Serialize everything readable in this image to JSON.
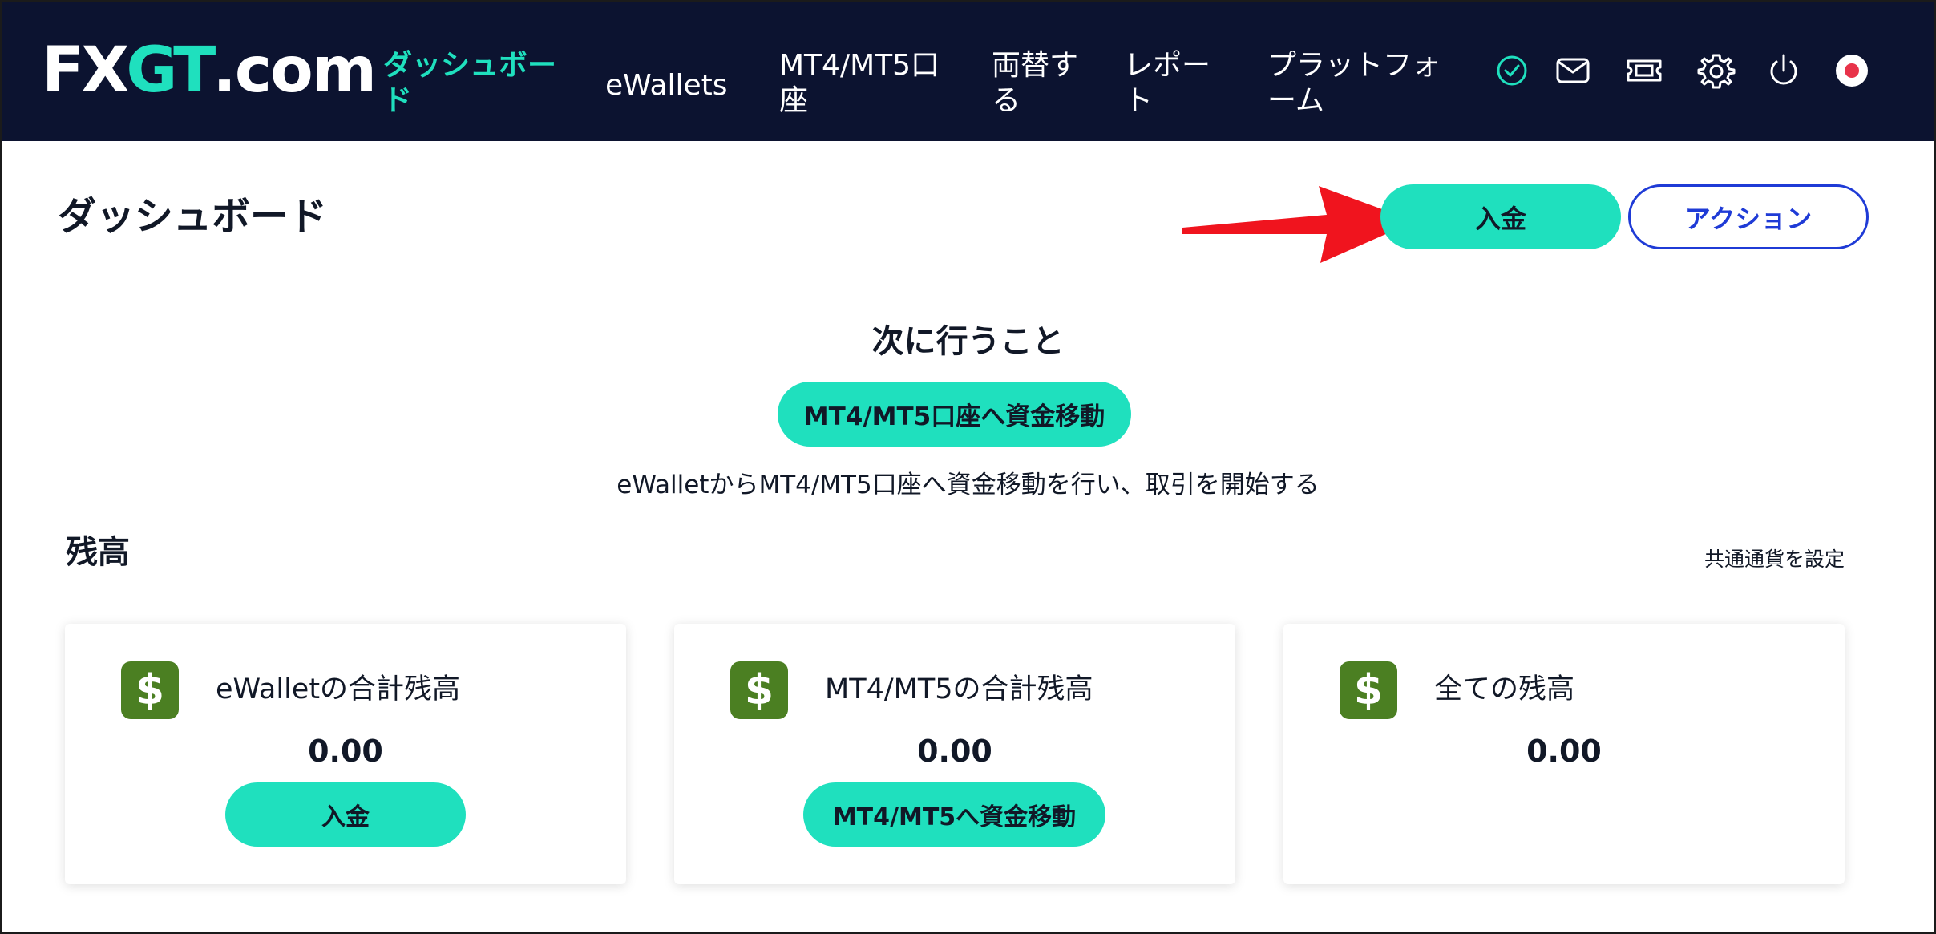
{
  "header": {
    "logo": {
      "part1": "FX",
      "part2": "GT",
      "part3": ".com"
    },
    "nav": [
      {
        "line1": "ダッシュボー",
        "line2": "ド",
        "active": true
      },
      {
        "line1": "eWallets",
        "line2": "",
        "active": false
      },
      {
        "line1": "MT4/MT5口",
        "line2": "座",
        "active": false
      },
      {
        "line1": "両替す",
        "line2": "る",
        "active": false
      },
      {
        "line1": "レポー",
        "line2": "ト",
        "active": false
      },
      {
        "line1": "プラットフォ",
        "line2": "ーム",
        "active": false
      }
    ],
    "icons": [
      "verified-check-icon",
      "mail-icon",
      "ticket-icon",
      "gear-icon",
      "power-icon",
      "japan-flag-icon"
    ],
    "colors": {
      "background": "#0c1330",
      "accent": "#1fe0be"
    }
  },
  "page": {
    "title": "ダッシュボード",
    "deposit_button": "入金",
    "action_button": "アクション"
  },
  "next_steps": {
    "title": "次に行うこと",
    "button": "MT4/MT5口座へ資金移動",
    "description": "eWalletからMT4/MT5口座へ資金移動を行い、取引を開始する"
  },
  "balance": {
    "title": "残高",
    "currency_link": "共通通貨を設定",
    "cards": [
      {
        "icon": "$",
        "title": "eWalletの合計残高",
        "value": "0.00",
        "button": "入金"
      },
      {
        "icon": "$",
        "title": "MT4/MT5の合計残高",
        "value": "0.00",
        "button": "MT4/MT5へ資金移動"
      },
      {
        "icon": "$",
        "title": "全ての残高",
        "value": "0.00"
      }
    ]
  },
  "colors": {
    "teal": "#1fe0be",
    "outline_blue": "#1f3bd6",
    "dollar_green": "#4b7f22",
    "annotation_red": "#f0141e"
  }
}
